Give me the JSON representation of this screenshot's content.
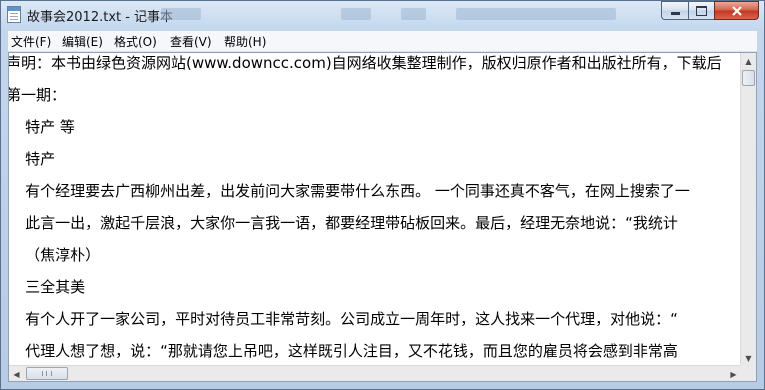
{
  "window": {
    "title": "故事会2012.txt - 记事本",
    "icon": "notepad-icon"
  },
  "caption_buttons": {
    "minimize": "minimize-icon",
    "maximize": "maximize-icon",
    "close": "close-icon"
  },
  "menu": [
    {
      "label": "文件(F)"
    },
    {
      "label": "编辑(E)"
    },
    {
      "label": "格式(O)"
    },
    {
      "label": "查看(V)"
    },
    {
      "label": "帮助(H)"
    }
  ],
  "document": {
    "lines": [
      "声明：本书由绿色资源网站(www.downcc.com)自网络收集整理制作，版权归原作者和出版社所有，下载后",
      "第一期：",
      "    特产 等",
      "    特产",
      "    有个经理要去广西柳州出差，出发前问大家需要带什么东西。 一个同事还真不客气，在网上搜索了一",
      "    此言一出，激起千层浪，大家你一言我一语，都要经理带砧板回来。最后，经理无奈地说：“我统计",
      "    （焦淳朴）",
      "    三全其美",
      "    有个人开了一家公司，平时对待员工非常苛刻。公司成立一周年时，这人找来一个代理，对他说：“",
      "    代理人想了想，说：“那就请您上吊吧，这样既引人注目，又不花钱，而且您的雇员将会感到非常高"
    ]
  },
  "scrollbars": {
    "up_arrow": "▲",
    "down_arrow": "▼",
    "left_arrow": "◀",
    "right_arrow": "▶"
  }
}
